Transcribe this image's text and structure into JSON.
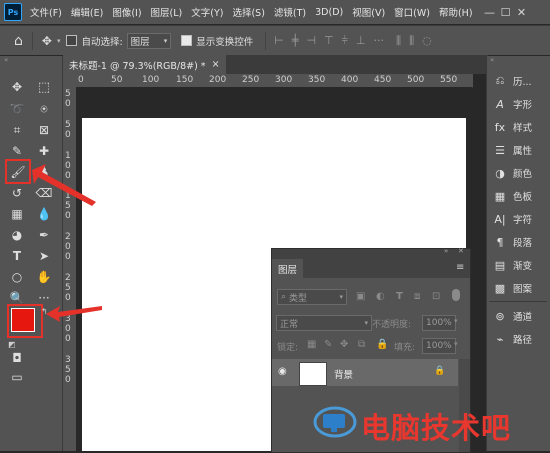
{
  "app": {
    "logo": "Ps"
  },
  "menu": [
    "文件(F)",
    "编辑(E)",
    "图像(I)",
    "图层(L)",
    "文字(Y)",
    "选择(S)",
    "滤镜(T)",
    "3D(D)",
    "视图(V)",
    "窗口(W)",
    "帮助(H)"
  ],
  "window_controls": {
    "minimize": "—",
    "maximize": "☐",
    "close": "✕"
  },
  "options": {
    "auto_select_label": "自动选择:",
    "auto_select_value": "图层",
    "show_transform_label": "显示变换控件"
  },
  "document": {
    "tab_title": "未标题-1 @ 79.3%(RGB/8#) *",
    "tab_close": "×"
  },
  "ruler_h": [
    "0",
    "50",
    "100",
    "150",
    "200",
    "250",
    "300",
    "350",
    "400",
    "450",
    "500",
    "550"
  ],
  "ruler_v": [
    "5",
    "0",
    "5",
    "0",
    "1",
    "0",
    "0",
    "1",
    "5",
    "0",
    "2",
    "0",
    "0",
    "2",
    "5",
    "0",
    "3",
    "0",
    "0",
    "3",
    "5",
    "0"
  ],
  "right_panels": [
    {
      "icon": "history-icon",
      "label": "历..."
    },
    {
      "icon": "character-icon",
      "label": "字形"
    },
    {
      "icon": "styles-icon",
      "label": "样式"
    },
    {
      "icon": "properties-icon",
      "label": "属性"
    },
    {
      "icon": "color-icon",
      "label": "颜色"
    },
    {
      "icon": "swatches-icon",
      "label": "色板"
    },
    {
      "icon": "type-icon",
      "label": "字符"
    },
    {
      "icon": "paragraph-icon",
      "label": "段落"
    },
    {
      "icon": "gradient-icon",
      "label": "渐变"
    },
    {
      "icon": "pattern-icon",
      "label": "图案"
    },
    {
      "icon": "channels-icon",
      "label": "通道"
    },
    {
      "icon": "paths-icon",
      "label": "路径"
    }
  ],
  "layers_panel": {
    "tab": "图层",
    "filter_placeholder": "类型",
    "blend_mode": "正常",
    "opacity_label": "不透明度:",
    "opacity_value": "100%",
    "lock_label": "锁定:",
    "fill_label": "填充:",
    "fill_value": "100%",
    "layer_name": "背景"
  },
  "colors": {
    "foreground": "#e5170f",
    "background": "#ffffff",
    "annotation": "#e4322b",
    "watermark": "#e8372e"
  },
  "watermark": {
    "text": "电脑技术吧"
  }
}
